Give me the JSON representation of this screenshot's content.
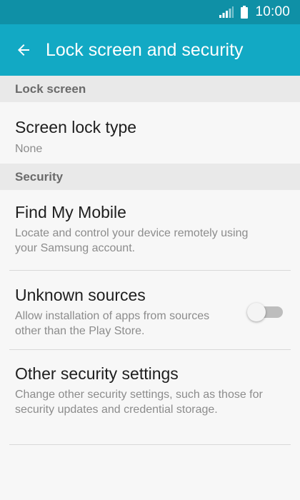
{
  "status_bar": {
    "time": "10:00",
    "icons": [
      "signal-icon",
      "battery-icon"
    ],
    "background_color": "#0f90a6"
  },
  "app_bar": {
    "title": "Lock screen and security",
    "back_icon": "arrow-back-icon",
    "background_color": "#12a9c4"
  },
  "sections": {
    "lock_screen": {
      "header": "Lock screen",
      "items": [
        {
          "title": "Screen lock type",
          "subtitle": "None"
        }
      ]
    },
    "security": {
      "header": "Security",
      "items": [
        {
          "title": "Find My Mobile",
          "subtitle": "Locate and control your device remotely using your Samsung account."
        },
        {
          "title": "Unknown sources",
          "subtitle": "Allow installation of apps from sources other than the Play Store.",
          "toggle_on": false
        },
        {
          "title": "Other security settings",
          "subtitle": "Change other security settings, such as those for security updates and credential storage."
        }
      ]
    }
  }
}
